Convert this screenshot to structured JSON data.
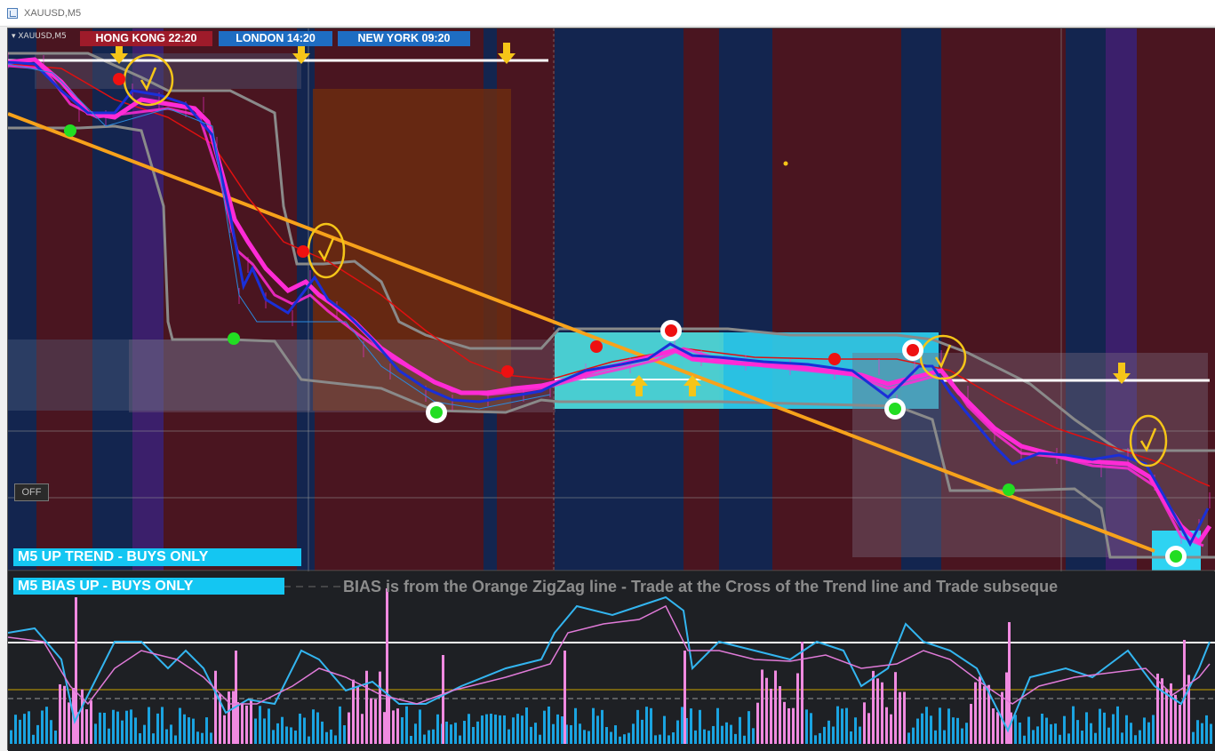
{
  "window": {
    "title": "XAUUSD,M5"
  },
  "chart": {
    "symbol_label": "XAUUSD,M5",
    "sessions": [
      {
        "label": "HONG KONG  22:20",
        "color": "#9e1b2a"
      },
      {
        "label": "LONDON   14:20",
        "color": "#1e6dc2"
      },
      {
        "label": "NEW YORK  09:20",
        "color": "#1e6dc2"
      }
    ],
    "off_button": "OFF",
    "trend_banner": "M5 UP TREND - BUYS ONLY",
    "bias_banner": "M5  BIAS UP - BUYS ONLY",
    "bias_note": "BIAS is from the Orange ZigZag line - Trade at the Cross of the Trend line  and Trade subseque"
  },
  "colors": {
    "background": "#000000",
    "zone_red": "#4a1520",
    "zone_blue": "#13254f",
    "zone_purple": "#3b1f6b",
    "zone_orange": "#6b2c10",
    "zone_cyan": "#2ed3f2",
    "price_magenta": "#ff2bd6",
    "price_blue": "#1a2fd8",
    "trendline_orange": "#f7a21b",
    "level_white": "#ffffff",
    "envelope_gray": "#8a8a8a",
    "ma_red": "#e01010",
    "arrow_yellow": "#f5c518",
    "dot_green": "#22dd22",
    "dot_red": "#ee1111",
    "indicator_bg": "#1e2024",
    "hist_blue": "#1aa3e0",
    "hist_pink": "#f08ae0",
    "osc_cyan": "#33b5f0",
    "osc_pink": "#e07ad8"
  },
  "icons": [
    "chart-window-icon",
    "down-arrow-icon",
    "up-arrow-icon",
    "checkmark-icon",
    "signal-dot-icon"
  ]
}
